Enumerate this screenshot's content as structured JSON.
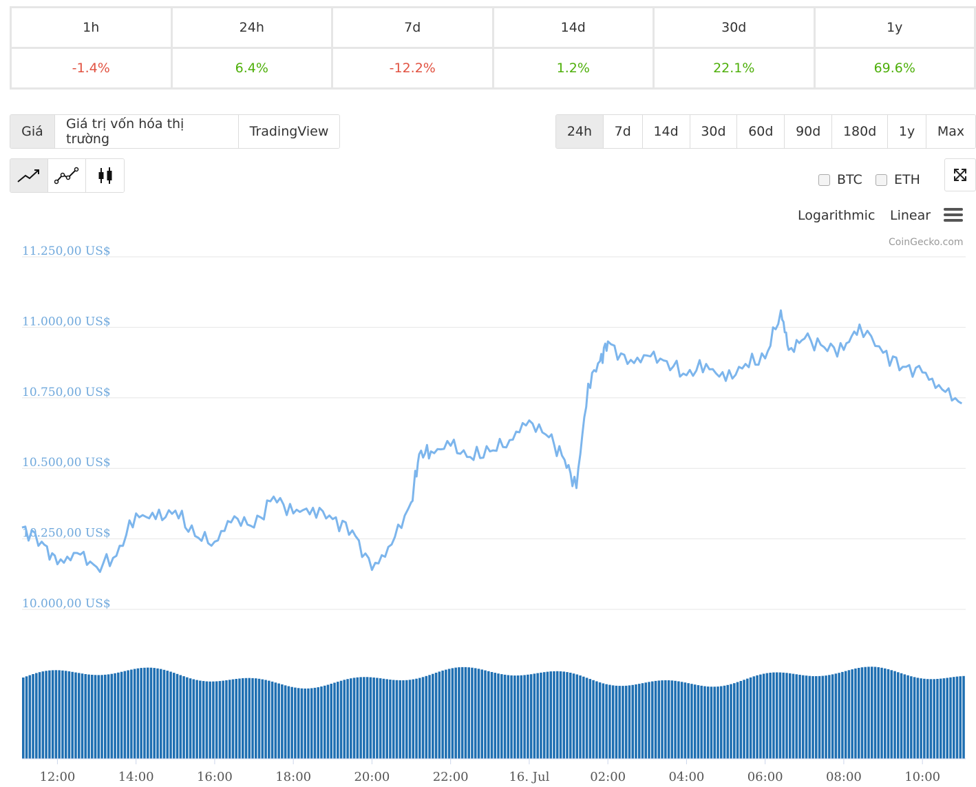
{
  "change_table": {
    "periods": [
      "1h",
      "24h",
      "7d",
      "14d",
      "30d",
      "1y"
    ],
    "changes": [
      "-1.4%",
      "6.4%",
      "-12.2%",
      "1.2%",
      "22.1%",
      "69.6%"
    ],
    "directions": [
      "neg",
      "pos",
      "neg",
      "pos",
      "pos",
      "pos"
    ]
  },
  "view_tabs": [
    "Giá",
    "Giá trị vốn hóa thị trường",
    "TradingView"
  ],
  "range_tabs": [
    "24h",
    "7d",
    "14d",
    "30d",
    "60d",
    "90d",
    "180d",
    "1y",
    "Max"
  ],
  "chart_type_icons": [
    "line-chart-icon",
    "line-markers-chart-icon",
    "candlestick-icon"
  ],
  "compare": {
    "btc": "BTC",
    "eth": "ETH"
  },
  "scale": {
    "log": "Logarithmic",
    "linear": "Linear"
  },
  "credit": "CoinGecko.com",
  "colors": {
    "line": "#7cb5ec",
    "volume": "#1f6fb2",
    "axis_label": "#6fa8dc",
    "neg": "#e15241",
    "pos": "#4eaf0a"
  },
  "chart_data": {
    "type": "line",
    "ylim": [
      10000,
      11250
    ],
    "y_tick_labels": [
      "11.250,00 US$",
      "11.000,00 US$",
      "10.750,00 US$",
      "10.500,00 US$",
      "10.250,00 US$",
      "10.000,00 US$"
    ],
    "y_tick_values": [
      11250,
      11000,
      10750,
      10500,
      10250,
      10000
    ],
    "x_tick_labels": [
      "12:00",
      "14:00",
      "16:00",
      "18:00",
      "20:00",
      "22:00",
      "16. Jul",
      "02:00",
      "04:00",
      "06:00",
      "08:00",
      "10:00"
    ],
    "x_range_hours": [
      11.1,
      35.1
    ],
    "x_tick_hours": [
      12,
      14,
      16,
      18,
      20,
      22,
      24,
      26,
      28,
      30,
      32,
      34
    ],
    "series": [
      {
        "x_hours": [
          11.1,
          11.6,
          12.0,
          12.5,
          13.0,
          13.5,
          14.0,
          14.5,
          15.0,
          15.5,
          16.0,
          16.5,
          17.0,
          17.5,
          18.0,
          18.5,
          19.0,
          19.5,
          20.0,
          20.5,
          21.0,
          21.2,
          21.5,
          22.0,
          22.5,
          23.0,
          23.5,
          24.0,
          24.5,
          24.9,
          25.2,
          25.5,
          25.8,
          26.0,
          26.5,
          27.0,
          27.5,
          28.0,
          28.5,
          29.0,
          29.5,
          30.0,
          30.4,
          30.6,
          31.0,
          31.5,
          32.0,
          32.4,
          33.0,
          33.5,
          34.0,
          34.5,
          35.0
        ],
        "values": [
          10290,
          10240,
          10160,
          10200,
          10150,
          10190,
          10340,
          10320,
          10350,
          10260,
          10240,
          10330,
          10290,
          10400,
          10340,
          10360,
          10320,
          10280,
          10140,
          10230,
          10380,
          10550,
          10560,
          10580,
          10540,
          10560,
          10600,
          10670,
          10610,
          10530,
          10430,
          10800,
          10880,
          10950,
          10870,
          10900,
          10880,
          10830,
          10870,
          10810,
          10870,
          10890,
          11060,
          10920,
          10960,
          10930,
          10920,
          11010,
          10910,
          10860,
          10840,
          10780,
          10730
        ]
      }
    ],
    "volume_level_description": "volume bars nearly uniform height"
  }
}
